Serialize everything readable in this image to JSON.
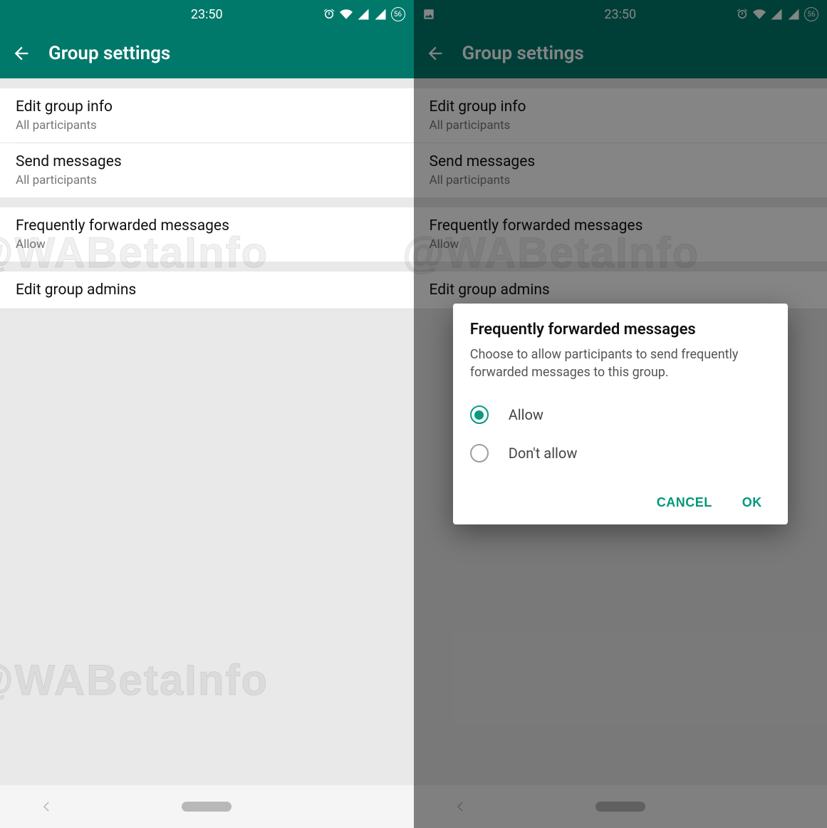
{
  "watermark": "@WABetaInfo",
  "statusbar": {
    "time": "23:50",
    "battery_badge": "56"
  },
  "appbar": {
    "title": "Group settings"
  },
  "settings": {
    "edit_group_info": {
      "title": "Edit group info",
      "sub": "All participants"
    },
    "send_messages": {
      "title": "Send messages",
      "sub": "All participants"
    },
    "ffm": {
      "title": "Frequently forwarded messages",
      "sub": "Allow"
    },
    "edit_admins": {
      "title": "Edit group admins"
    }
  },
  "dialog": {
    "title": "Frequently forwarded messages",
    "description": "Choose to allow participants to send frequently forwarded messages to this group.",
    "options": {
      "allow": "Allow",
      "dont_allow": "Don't allow"
    },
    "selected": "allow",
    "cancel": "CANCEL",
    "ok": "OK"
  }
}
